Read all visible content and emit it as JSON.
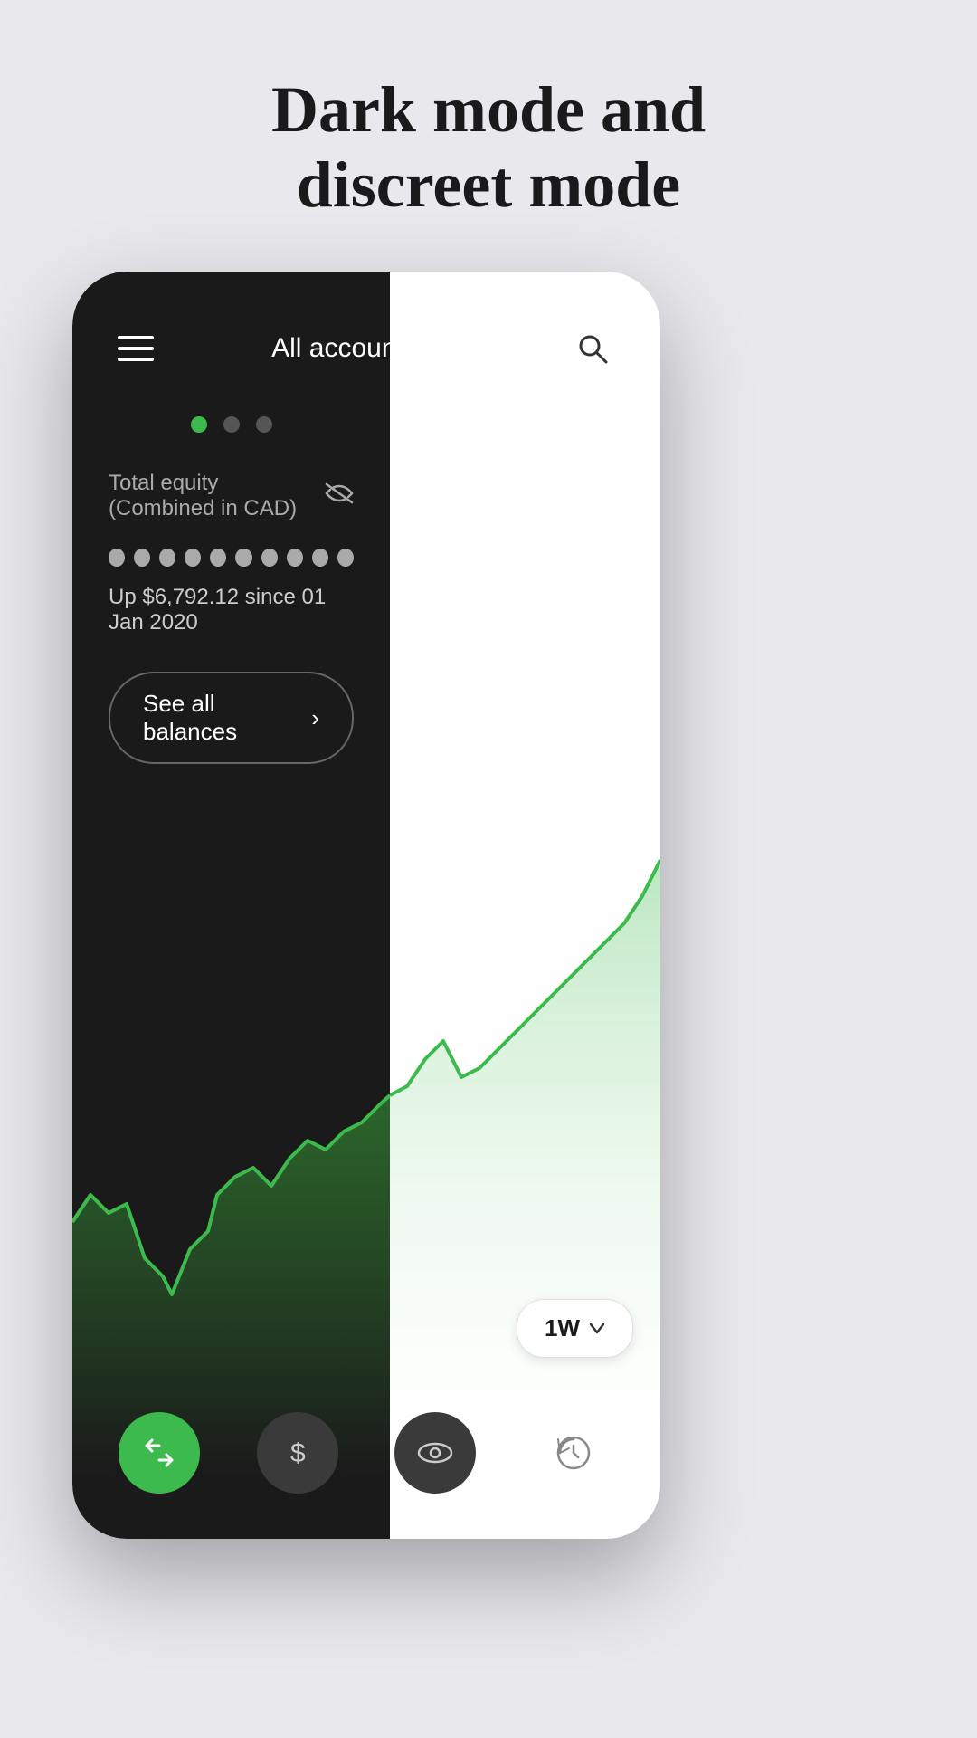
{
  "page": {
    "background_color": "#e8e8ed",
    "title_line1": "Dark mode and",
    "title_line2": "discreet mode"
  },
  "header": {
    "account_selector_label": "All accounts",
    "hamburger_icon": "menu-icon",
    "search_icon": "search-icon",
    "dropdown_icon": "chevron-down-icon"
  },
  "dots": [
    {
      "active": true
    },
    {
      "active": false
    },
    {
      "active": false
    }
  ],
  "equity": {
    "label": "Total equity (Combined in CAD)",
    "hidden": true,
    "hidden_dots_count": 10,
    "change_text": "Up $6,792.12 since 01 Jan 2020",
    "see_all_label": "See all balances"
  },
  "chart": {
    "time_selector": "1W",
    "time_selector_icon": "chevron-down-icon"
  },
  "bottom_nav": [
    {
      "icon": "transfer-icon",
      "type": "green",
      "label": "Transfer"
    },
    {
      "icon": "dollar-icon",
      "type": "gray",
      "label": "Cash"
    },
    {
      "icon": "eye-icon",
      "type": "gray",
      "label": "Watch"
    },
    {
      "icon": "history-icon",
      "type": "plain",
      "label": "History"
    }
  ]
}
